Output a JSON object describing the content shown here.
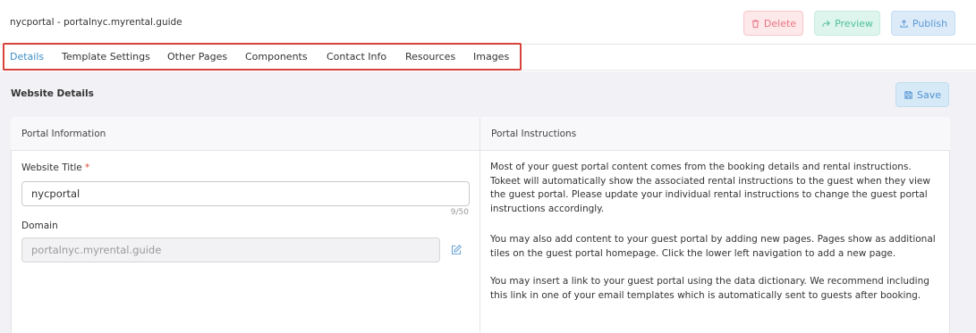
{
  "header": {
    "title": "nycportal - portalnyc.myrental.guide",
    "delete_label": "Delete",
    "preview_label": "Preview",
    "publish_label": "Publish"
  },
  "tabs": [
    {
      "label": "Details",
      "active": true
    },
    {
      "label": "Template Settings",
      "active": false
    },
    {
      "label": "Other Pages",
      "active": false
    },
    {
      "label": "Components",
      "active": false
    },
    {
      "label": "Contact Info",
      "active": false
    },
    {
      "label": "Resources",
      "active": false
    },
    {
      "label": "Images",
      "active": false
    }
  ],
  "main": {
    "section_title": "Website Details",
    "save_label": "Save",
    "left_header": "Portal Information",
    "right_header": "Portal Instructions",
    "website_title_label": "Website Title",
    "website_title_required": "*",
    "website_title_value": "nycportal",
    "website_title_counter": "9/50",
    "domain_label": "Domain",
    "domain_value": "portalnyc.myrental.guide",
    "instructions": [
      "Most of your guest portal content comes from the booking details and rental instructions. Tokeet will automatically show the associated rental instructions to the guest when they view the guest portal. Please update your individual rental instructions to change the guest portal instructions accordingly.",
      "You may also add content to your guest portal by adding new pages. Pages show as additional tiles on the guest portal homepage. Click the lower left navigation to add a new page.",
      "You may insert a link to your guest portal using the data dictionary. We recommend including this link in one of your email templates which is automatically sent to guests after booking."
    ]
  },
  "icons": {
    "delete": "trash-icon",
    "preview": "share-icon",
    "publish": "upload-icon",
    "save": "save-icon",
    "edit": "edit-icon"
  },
  "colors": {
    "active_tab": "#3d8fc4",
    "highlight_box": "#d9423a",
    "delete": "#e87482",
    "preview": "#4fbf9c",
    "publish": "#5a99d6",
    "required": "#e0453a"
  }
}
